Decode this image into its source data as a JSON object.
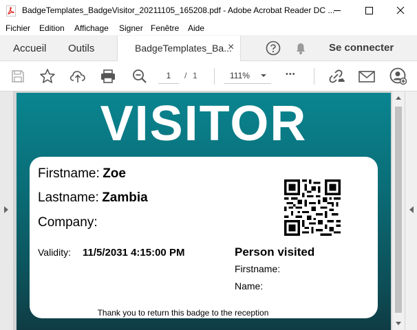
{
  "window": {
    "title": "BadgeTemplates_BadgeVisitor_20211105_165208.pdf - Adobe Acrobat Reader DC ...",
    "minimize": "–",
    "maximize": "☐",
    "close": "✕"
  },
  "menu": [
    "Fichier",
    "Edition",
    "Affichage",
    "Signer",
    "Fenêtre",
    "Aide"
  ],
  "tabs": {
    "home": "Accueil",
    "tools": "Outils",
    "document": "BadgeTemplates_Ba...",
    "close": "×",
    "connect": "Se connecter"
  },
  "toolbar": {
    "page_current": "1",
    "page_sep": "/",
    "page_total": "1",
    "zoom": "111%",
    "more": "•••"
  },
  "badge": {
    "heading": "VISITOR",
    "firstname_label": "Firstname:",
    "firstname_value": "Zoe",
    "lastname_label": "Lastname:",
    "lastname_value": "Zambia",
    "company_label": "Company:",
    "validity_label": "Validity:",
    "validity_value": "11/5/2031 4:15:00 PM",
    "person_visited": "Person visited",
    "pv_firstname": "Firstname:",
    "pv_name": "Name:",
    "footer": "Thank you to return this badge to the reception"
  },
  "colors": {
    "badge_top": "#0a8590",
    "badge_bottom": "#0f3c44",
    "acrobat_red": "#e0221c"
  }
}
